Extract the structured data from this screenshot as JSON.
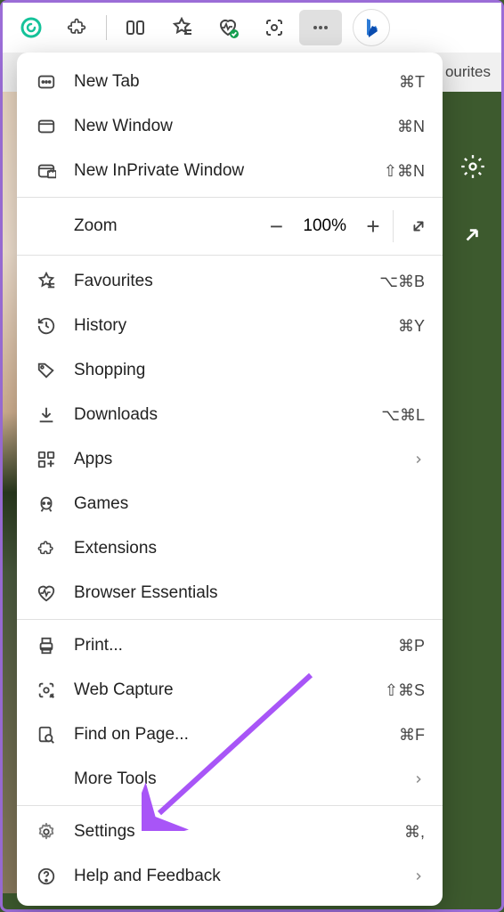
{
  "toolbar": {
    "favourites_label": "ourites"
  },
  "menu": {
    "new_tab": {
      "label": "New Tab",
      "shortcut": "⌘T"
    },
    "new_window": {
      "label": "New Window",
      "shortcut": "⌘N"
    },
    "new_inprivate": {
      "label": "New InPrivate Window",
      "shortcut": "⇧⌘N"
    },
    "zoom": {
      "label": "Zoom",
      "value": "100%"
    },
    "favourites": {
      "label": "Favourites",
      "shortcut": "⌥⌘B"
    },
    "history": {
      "label": "History",
      "shortcut": "⌘Y"
    },
    "shopping": {
      "label": "Shopping"
    },
    "downloads": {
      "label": "Downloads",
      "shortcut": "⌥⌘L"
    },
    "apps": {
      "label": "Apps"
    },
    "games": {
      "label": "Games"
    },
    "extensions": {
      "label": "Extensions"
    },
    "browser_essentials": {
      "label": "Browser Essentials"
    },
    "print": {
      "label": "Print...",
      "shortcut": "⌘P"
    },
    "web_capture": {
      "label": "Web Capture",
      "shortcut": "⇧⌘S"
    },
    "find": {
      "label": "Find on Page...",
      "shortcut": "⌘F"
    },
    "more_tools": {
      "label": "More Tools"
    },
    "settings": {
      "label": "Settings",
      "shortcut": "⌘,"
    },
    "help": {
      "label": "Help and Feedback"
    }
  }
}
